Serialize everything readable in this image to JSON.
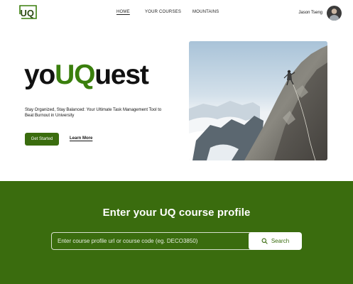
{
  "header": {
    "logo": {
      "text": "UQ",
      "brand_color": "#3a7f0d"
    },
    "nav": [
      {
        "label": "HOME",
        "active": true
      },
      {
        "label": "YOUR COURSES",
        "active": false
      },
      {
        "label": "MOUNTAINS",
        "active": false
      }
    ],
    "user": {
      "name": "Jason Tseng",
      "avatar_icon": "avatar"
    }
  },
  "hero": {
    "title_prefix": "yo",
    "title_accent": "UQ",
    "title_suffix": "uest",
    "tagline": "Stay Organized, Stay Balanced: Your Ultimate Task Management Tool to Beat Burnout in University",
    "primary_button": "Get Started",
    "secondary_link": "Learn More",
    "image_icon": "mountain-climber-photo"
  },
  "search": {
    "heading": "Enter your UQ course profile",
    "input_value": "",
    "placeholder": "Enter course profile url or course code (eg. DECO3850)",
    "button_label": "Search",
    "button_icon": "search-icon"
  },
  "colors": {
    "brand_green": "#3a6c0e",
    "accent_green": "#3a7f0d",
    "background": "#ffffff"
  }
}
